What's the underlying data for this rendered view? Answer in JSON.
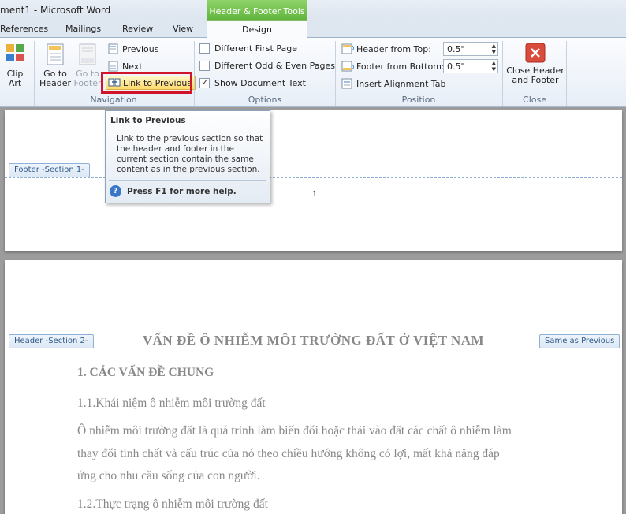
{
  "window": {
    "title": "ment1 - Microsoft Word",
    "contextual_group": "Header & Footer Tools"
  },
  "tabs": [
    "References",
    "Mailings",
    "Review",
    "View",
    "Design"
  ],
  "ribbon": {
    "insert": {
      "clip_art": "Clip\nArt"
    },
    "navigation": {
      "label": "Navigation",
      "go_to_header": "Go to\nHeader",
      "go_to_footer": "Go to\nFooter",
      "previous": "Previous",
      "next": "Next",
      "link_to_previous": "Link to Previous"
    },
    "options": {
      "label": "Options",
      "different_first_page": "Different First Page",
      "different_odd_even": "Different Odd & Even Pages",
      "show_document_text": "Show Document Text"
    },
    "position": {
      "label": "Position",
      "header_from_top": "Header from Top:",
      "header_from_top_value": "0.5\"",
      "footer_from_bottom": "Footer from Bottom:",
      "footer_from_bottom_value": "0.5\"",
      "insert_alignment_tab": "Insert Alignment Tab"
    },
    "close": {
      "label": "Close",
      "close_button": "Close Header\nand Footer"
    }
  },
  "tooltip": {
    "title": "Link to Previous",
    "body": "Link to the previous section so that the header and footer in the current section contain the same content as in the previous section.",
    "help": "Press F1 for more help."
  },
  "document": {
    "footer_tag": "Footer -Section 1-",
    "page_number": "1",
    "header_tag": "Header -Section 2-",
    "same_as_previous": "Same as Previous",
    "heading": "VẤN ĐỀ Ô NHIỄM MÔI TRƯỜNG ĐẤT Ở VIỆT NAM",
    "section_title": "1. CÁC VẤN ĐỀ CHUNG",
    "subsection_1": "1.1.Khái niệm ô nhiễm môi trường đất",
    "paragraph_lines": [
      "Ô nhiễm môi trường đất là quá trình làm biến đổi hoặc thải vào đất các chất ô nhiễm làm",
      "thay đổi tính chất và cấu trúc của nó theo chiều hướng không có lợi, mất khả năng đáp",
      "ứng cho nhu cầu sống của con người."
    ],
    "subsection_2": "1.2.Thực trạng ô nhiễm môi trường đất"
  }
}
